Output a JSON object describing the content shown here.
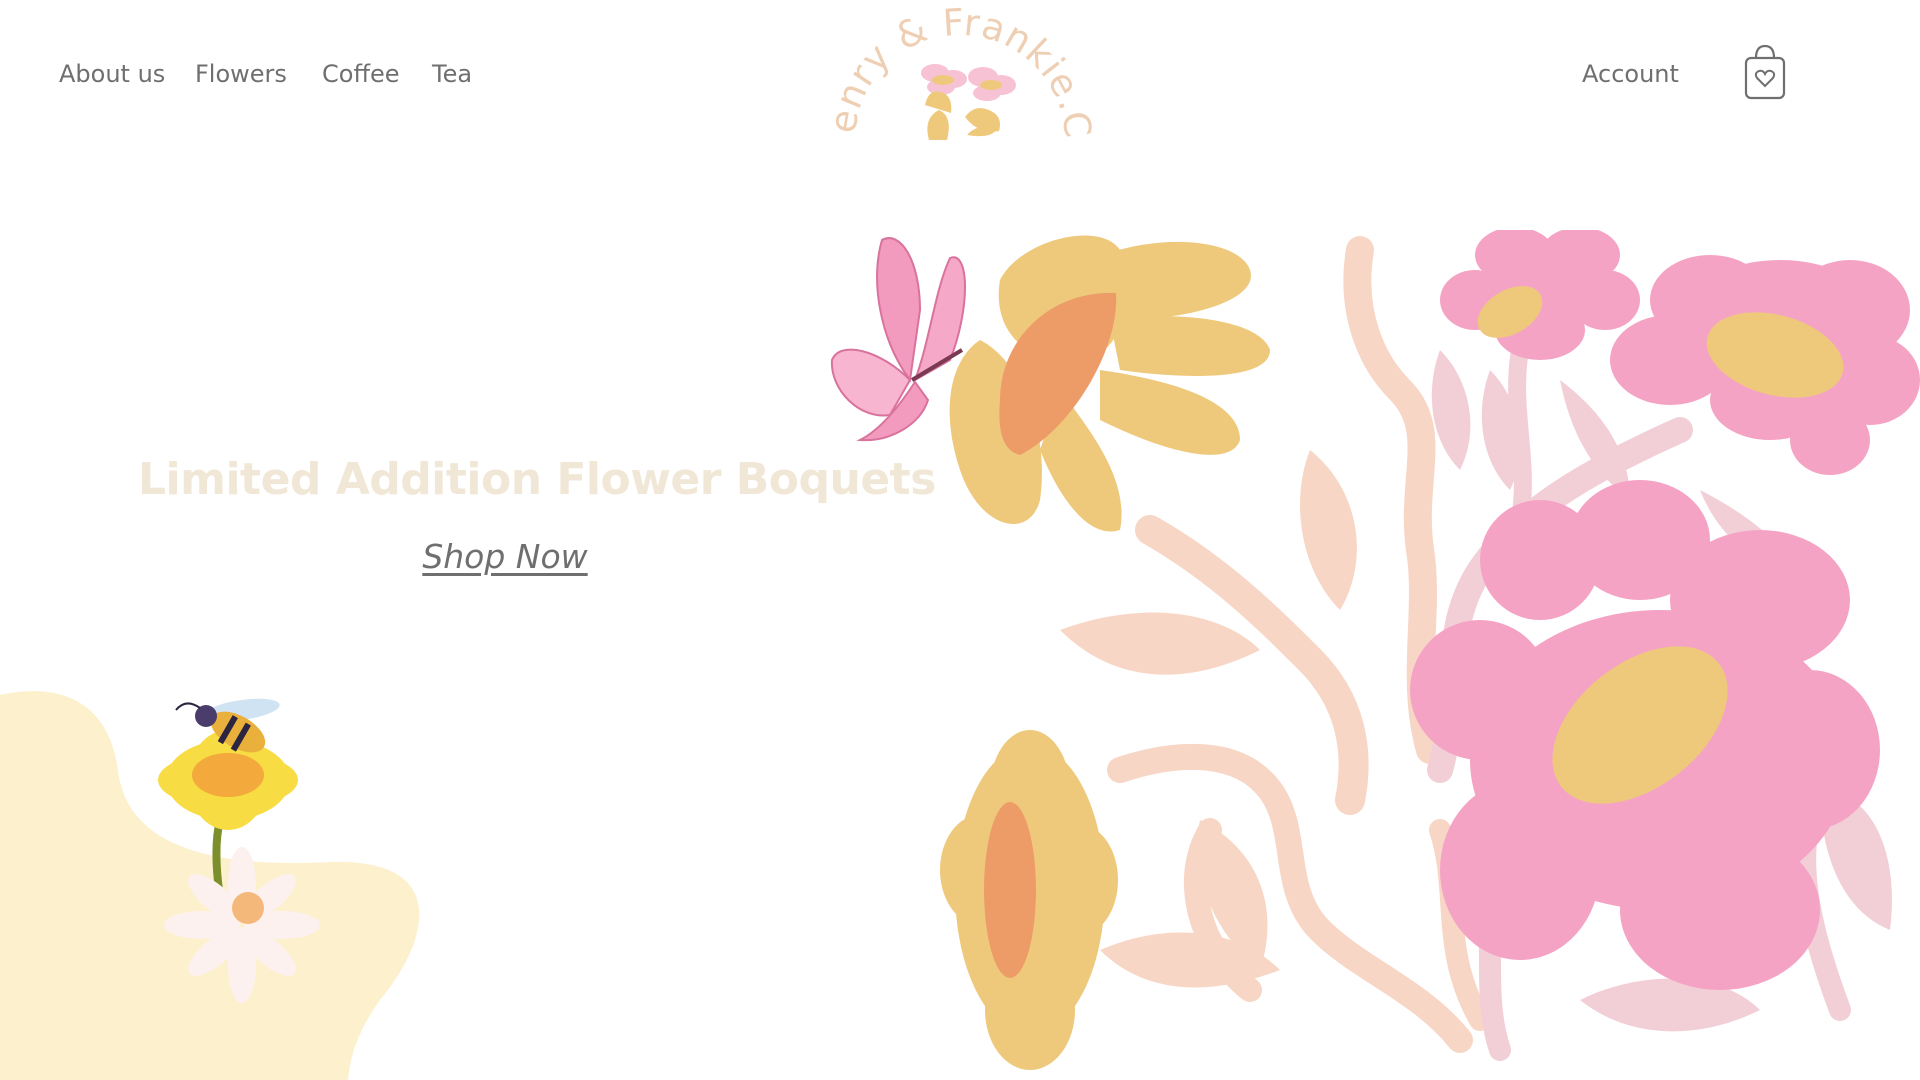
{
  "nav": {
    "left_links": [
      {
        "label": "About us"
      },
      {
        "label": "Flowers"
      },
      {
        "label": "Coffee"
      },
      {
        "label": "Tea"
      }
    ],
    "account_label": "Account",
    "cart_icon": "shopping-bag-heart-icon"
  },
  "logo": {
    "text": "Henry & Frankie.Co",
    "icon": "flower-pots-icon"
  },
  "hero": {
    "title": "Limited Addition Flower Boquets",
    "cta_label": "Shop Now"
  },
  "colors": {
    "nav_text": "#6f6f6f",
    "hero_title": "#f1e7d6",
    "logo": "#efcfb3",
    "pink": "#f5a3c4",
    "yellow": "#eec97c",
    "peach": "#f8d6c6",
    "cream_blob": "#fdf0cd"
  }
}
